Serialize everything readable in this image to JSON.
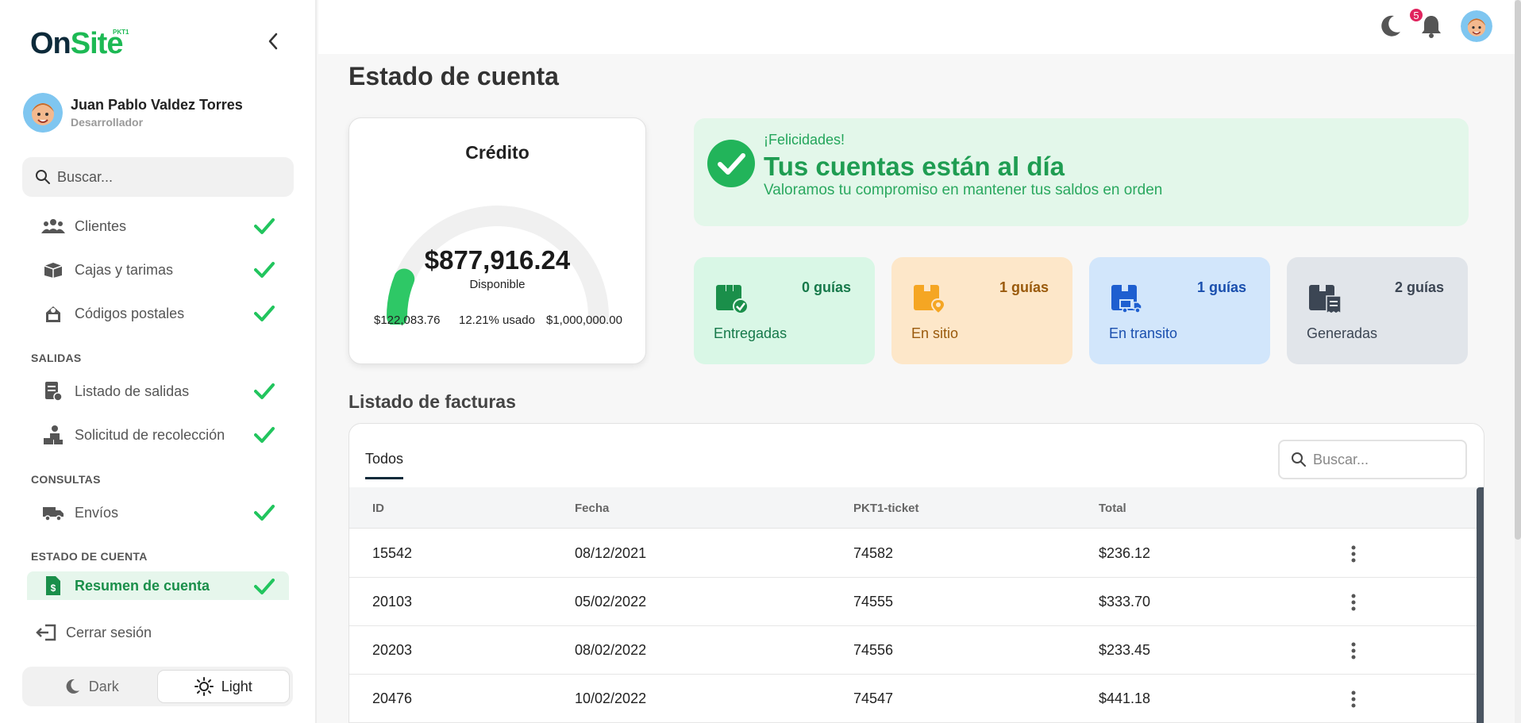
{
  "brand": {
    "logo_on": "On",
    "logo_site": "Site",
    "logo_sup": "PKT1"
  },
  "user": {
    "name": "Juan Pablo Valdez Torres",
    "role": "Desarrollador"
  },
  "sidebar": {
    "search_placeholder": "Buscar...",
    "items_top": [
      {
        "label": "Clientes",
        "icon": "users-icon"
      },
      {
        "label": "Cajas y tarimas",
        "icon": "boxes-icon"
      },
      {
        "label": "Códigos postales",
        "icon": "postal-code-icon"
      }
    ],
    "section_salidas": "SALIDAS",
    "items_salidas": [
      {
        "label": "Listado de salidas",
        "icon": "document-list-icon"
      },
      {
        "label": "Solicitud de recolección",
        "icon": "pickup-icon"
      }
    ],
    "section_consultas": "CONSULTAS",
    "items_consultas": [
      {
        "label": "Envíos",
        "icon": "truck-icon"
      }
    ],
    "section_estado": "ESTADO DE CUENTA",
    "items_estado": [
      {
        "label": "Resumen de cuenta",
        "icon": "invoice-dollar-icon",
        "active": true
      }
    ],
    "logout_label": "Cerrar sesión",
    "theme_dark": "Dark",
    "theme_light": "Light",
    "theme_selected": "Light"
  },
  "topbar": {
    "notifications_count": "5"
  },
  "page": {
    "title": "Estado de cuenta"
  },
  "credit": {
    "title": "Crédito",
    "available": "$877,916.24",
    "available_label": "Disponible",
    "used_amount": "$122,083.76",
    "used_pct_label": "12.21% usado",
    "limit": "$1,000,000.00",
    "used_fraction": 0.1221
  },
  "congrats": {
    "small": "¡Felicidades!",
    "title": "Tus cuentas están al día",
    "desc": "Valoramos tu compromiso en mantener tus saldos en orden"
  },
  "stats": [
    {
      "count": "0 guías",
      "label": "Entregadas",
      "bg": "#d9f7e6",
      "color": "#16794a",
      "icon": "package-check-icon"
    },
    {
      "count": "1 guías",
      "label": "En sitio",
      "bg": "#fde7c9",
      "color": "#9a5a0c",
      "icon": "package-location-icon"
    },
    {
      "count": "1 guías",
      "label": "En transito",
      "bg": "#d2e6fb",
      "color": "#1a4fae",
      "icon": "truck-transit-icon"
    },
    {
      "count": "2 guías",
      "label": "Generadas",
      "bg": "#e1e5ea",
      "color": "#3c4654",
      "icon": "receipt-icon"
    }
  ],
  "invoices": {
    "title": "Listado de facturas",
    "tab_all": "Todos",
    "search_placeholder": "Buscar...",
    "columns": [
      "ID",
      "Fecha",
      "PKT1-ticket",
      "Total"
    ],
    "rows": [
      [
        "15542",
        "08/12/2021",
        "74582",
        "$236.12"
      ],
      [
        "20103",
        "05/02/2022",
        "74555",
        "$333.70"
      ],
      [
        "20203",
        "08/02/2022",
        "74556",
        "$233.45"
      ],
      [
        "20476",
        "10/02/2022",
        "74547",
        "$441.18"
      ]
    ]
  },
  "colors": {
    "accent_green": "#1f9d52",
    "check_green": "#22c55e",
    "navy": "#0d2a3a",
    "badge": "#e0245e"
  }
}
